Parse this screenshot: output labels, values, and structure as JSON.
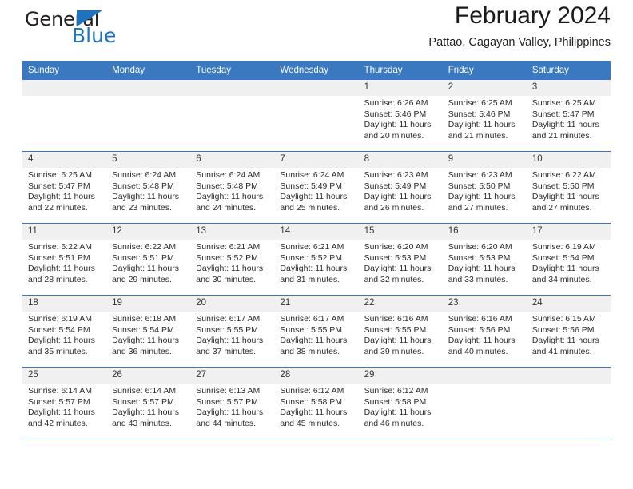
{
  "brand": {
    "word_one": "General",
    "word_two": "Blue",
    "accent_color": "#1d73be"
  },
  "header": {
    "title": "February 2024",
    "subtitle": "Pattao, Cagayan Valley, Philippines",
    "header_bg": "#3a79c0"
  },
  "weekdays": [
    "Sunday",
    "Monday",
    "Tuesday",
    "Wednesday",
    "Thursday",
    "Friday",
    "Saturday"
  ],
  "weeks": [
    [
      {
        "day": "",
        "lines": []
      },
      {
        "day": "",
        "lines": []
      },
      {
        "day": "",
        "lines": []
      },
      {
        "day": "",
        "lines": []
      },
      {
        "day": "1",
        "lines": [
          "Sunrise: 6:26 AM",
          "Sunset: 5:46 PM",
          "Daylight: 11 hours",
          "and 20 minutes."
        ]
      },
      {
        "day": "2",
        "lines": [
          "Sunrise: 6:25 AM",
          "Sunset: 5:46 PM",
          "Daylight: 11 hours",
          "and 21 minutes."
        ]
      },
      {
        "day": "3",
        "lines": [
          "Sunrise: 6:25 AM",
          "Sunset: 5:47 PM",
          "Daylight: 11 hours",
          "and 21 minutes."
        ]
      }
    ],
    [
      {
        "day": "4",
        "lines": [
          "Sunrise: 6:25 AM",
          "Sunset: 5:47 PM",
          "Daylight: 11 hours",
          "and 22 minutes."
        ]
      },
      {
        "day": "5",
        "lines": [
          "Sunrise: 6:24 AM",
          "Sunset: 5:48 PM",
          "Daylight: 11 hours",
          "and 23 minutes."
        ]
      },
      {
        "day": "6",
        "lines": [
          "Sunrise: 6:24 AM",
          "Sunset: 5:48 PM",
          "Daylight: 11 hours",
          "and 24 minutes."
        ]
      },
      {
        "day": "7",
        "lines": [
          "Sunrise: 6:24 AM",
          "Sunset: 5:49 PM",
          "Daylight: 11 hours",
          "and 25 minutes."
        ]
      },
      {
        "day": "8",
        "lines": [
          "Sunrise: 6:23 AM",
          "Sunset: 5:49 PM",
          "Daylight: 11 hours",
          "and 26 minutes."
        ]
      },
      {
        "day": "9",
        "lines": [
          "Sunrise: 6:23 AM",
          "Sunset: 5:50 PM",
          "Daylight: 11 hours",
          "and 27 minutes."
        ]
      },
      {
        "day": "10",
        "lines": [
          "Sunrise: 6:22 AM",
          "Sunset: 5:50 PM",
          "Daylight: 11 hours",
          "and 27 minutes."
        ]
      }
    ],
    [
      {
        "day": "11",
        "lines": [
          "Sunrise: 6:22 AM",
          "Sunset: 5:51 PM",
          "Daylight: 11 hours",
          "and 28 minutes."
        ]
      },
      {
        "day": "12",
        "lines": [
          "Sunrise: 6:22 AM",
          "Sunset: 5:51 PM",
          "Daylight: 11 hours",
          "and 29 minutes."
        ]
      },
      {
        "day": "13",
        "lines": [
          "Sunrise: 6:21 AM",
          "Sunset: 5:52 PM",
          "Daylight: 11 hours",
          "and 30 minutes."
        ]
      },
      {
        "day": "14",
        "lines": [
          "Sunrise: 6:21 AM",
          "Sunset: 5:52 PM",
          "Daylight: 11 hours",
          "and 31 minutes."
        ]
      },
      {
        "day": "15",
        "lines": [
          "Sunrise: 6:20 AM",
          "Sunset: 5:53 PM",
          "Daylight: 11 hours",
          "and 32 minutes."
        ]
      },
      {
        "day": "16",
        "lines": [
          "Sunrise: 6:20 AM",
          "Sunset: 5:53 PM",
          "Daylight: 11 hours",
          "and 33 minutes."
        ]
      },
      {
        "day": "17",
        "lines": [
          "Sunrise: 6:19 AM",
          "Sunset: 5:54 PM",
          "Daylight: 11 hours",
          "and 34 minutes."
        ]
      }
    ],
    [
      {
        "day": "18",
        "lines": [
          "Sunrise: 6:19 AM",
          "Sunset: 5:54 PM",
          "Daylight: 11 hours",
          "and 35 minutes."
        ]
      },
      {
        "day": "19",
        "lines": [
          "Sunrise: 6:18 AM",
          "Sunset: 5:54 PM",
          "Daylight: 11 hours",
          "and 36 minutes."
        ]
      },
      {
        "day": "20",
        "lines": [
          "Sunrise: 6:17 AM",
          "Sunset: 5:55 PM",
          "Daylight: 11 hours",
          "and 37 minutes."
        ]
      },
      {
        "day": "21",
        "lines": [
          "Sunrise: 6:17 AM",
          "Sunset: 5:55 PM",
          "Daylight: 11 hours",
          "and 38 minutes."
        ]
      },
      {
        "day": "22",
        "lines": [
          "Sunrise: 6:16 AM",
          "Sunset: 5:55 PM",
          "Daylight: 11 hours",
          "and 39 minutes."
        ]
      },
      {
        "day": "23",
        "lines": [
          "Sunrise: 6:16 AM",
          "Sunset: 5:56 PM",
          "Daylight: 11 hours",
          "and 40 minutes."
        ]
      },
      {
        "day": "24",
        "lines": [
          "Sunrise: 6:15 AM",
          "Sunset: 5:56 PM",
          "Daylight: 11 hours",
          "and 41 minutes."
        ]
      }
    ],
    [
      {
        "day": "25",
        "lines": [
          "Sunrise: 6:14 AM",
          "Sunset: 5:57 PM",
          "Daylight: 11 hours",
          "and 42 minutes."
        ]
      },
      {
        "day": "26",
        "lines": [
          "Sunrise: 6:14 AM",
          "Sunset: 5:57 PM",
          "Daylight: 11 hours",
          "and 43 minutes."
        ]
      },
      {
        "day": "27",
        "lines": [
          "Sunrise: 6:13 AM",
          "Sunset: 5:57 PM",
          "Daylight: 11 hours",
          "and 44 minutes."
        ]
      },
      {
        "day": "28",
        "lines": [
          "Sunrise: 6:12 AM",
          "Sunset: 5:58 PM",
          "Daylight: 11 hours",
          "and 45 minutes."
        ]
      },
      {
        "day": "29",
        "lines": [
          "Sunrise: 6:12 AM",
          "Sunset: 5:58 PM",
          "Daylight: 11 hours",
          "and 46 minutes."
        ]
      },
      {
        "day": "",
        "lines": []
      },
      {
        "day": "",
        "lines": []
      }
    ]
  ]
}
